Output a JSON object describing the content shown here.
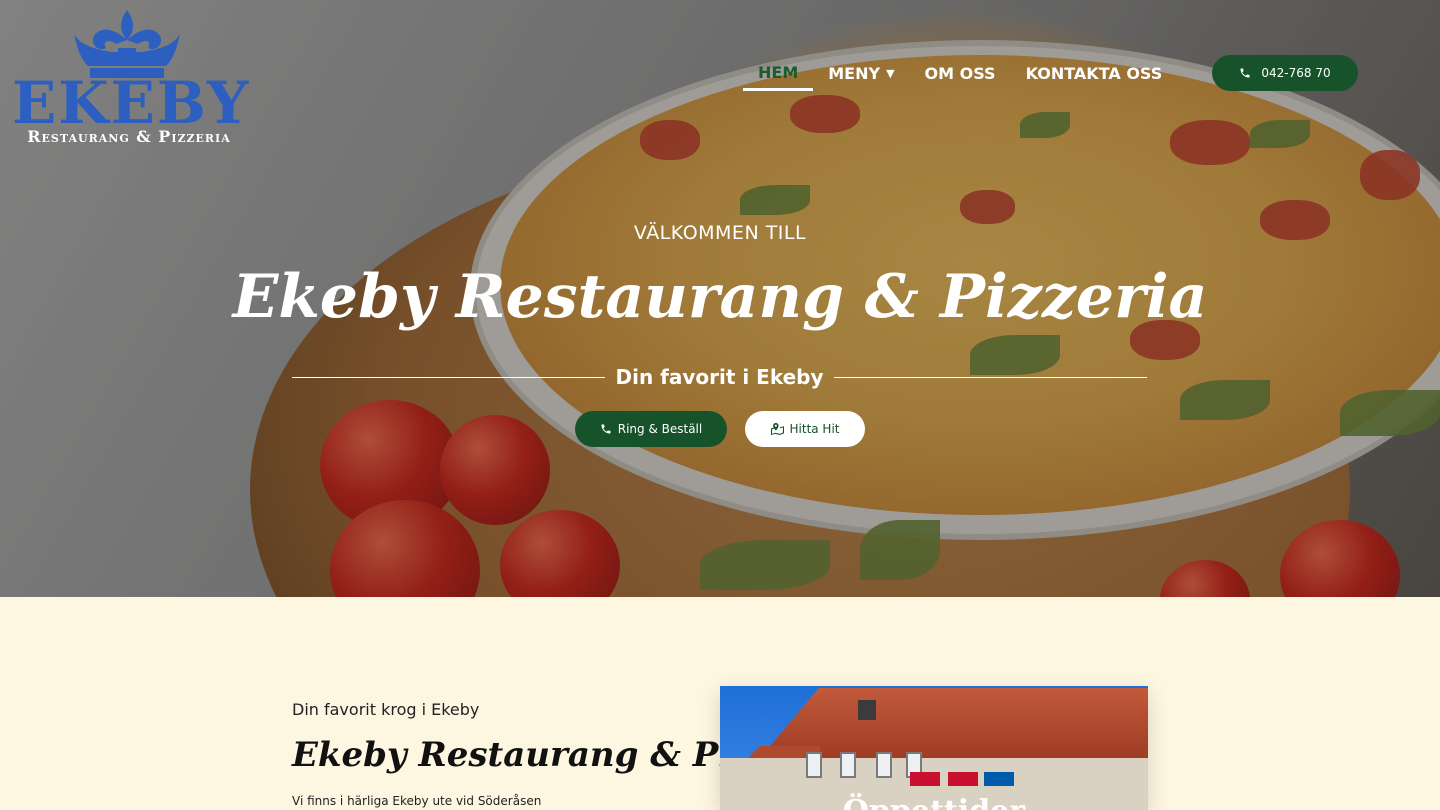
{
  "logo": {
    "brand": "EKEBY",
    "tagline": "Restaurang & Pizzeria",
    "icon": "crown-fleur-de-lis-icon"
  },
  "nav": {
    "items": [
      {
        "label": "HEM",
        "active": true
      },
      {
        "label": "MENY",
        "has_dropdown": true
      },
      {
        "label": "OM OSS"
      },
      {
        "label": "KONTAKTA OSS"
      }
    ],
    "phone": "042-768 70"
  },
  "hero": {
    "welcome": "VÄLKOMMEN TILL",
    "title": "Ekeby Restaurang & Pizzeria",
    "subtitle": "Din favorit i Ekeby",
    "cta_call": "Ring & Beställ",
    "cta_find": "Hitta Hit"
  },
  "about": {
    "kicker": "Din favorit krog i Ekeby",
    "title": "Ekeby Restaurang & Pizzeria",
    "intro": "Vi finns i härliga Ekeby ute vid Söderåsen",
    "photo_title": "Öppettider"
  },
  "colors": {
    "accent_green": "#16522a",
    "logo_blue": "#2c5fbf",
    "cream": "#fdf6e0"
  }
}
